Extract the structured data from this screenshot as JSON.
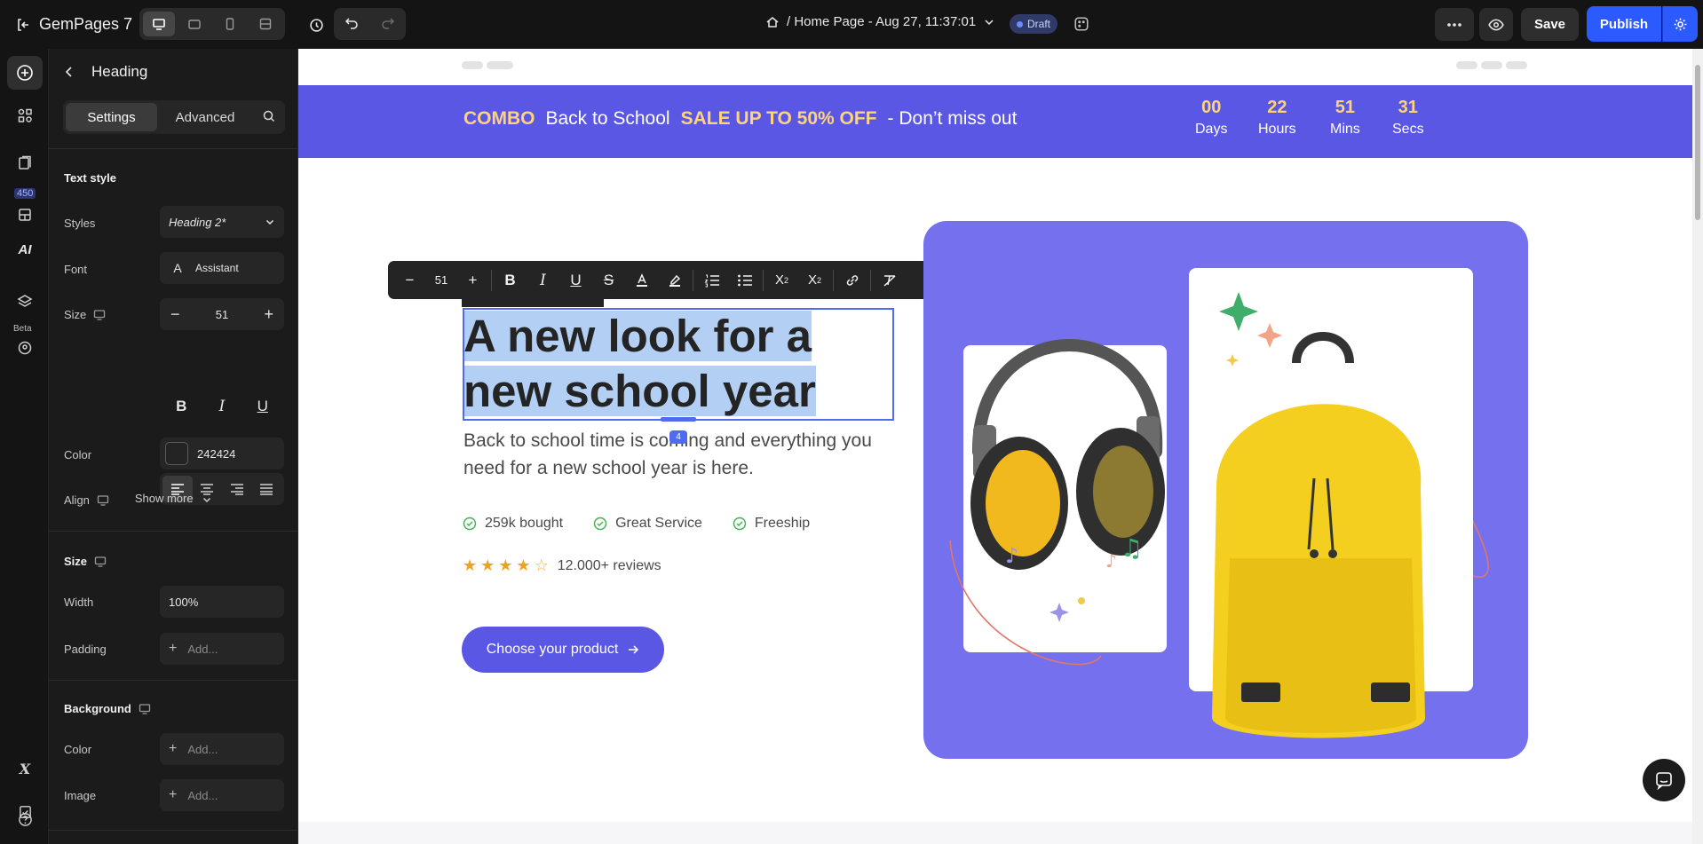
{
  "app": {
    "name": "GemPages 7",
    "page_title": "/ Home Page - Aug 27, 11:37:01",
    "status_badge": "Draft",
    "save_label": "Save",
    "publish_label": "Publish"
  },
  "rail": {
    "count_badge": "450",
    "beta_label": "Beta",
    "ai_label": "AI"
  },
  "panel": {
    "back_title": "Heading",
    "tabs": [
      "Settings",
      "Advanced"
    ],
    "text_style": {
      "title": "Text style",
      "styles_label": "Styles",
      "styles_value": "Heading 2*",
      "font_label": "Font",
      "font_value": "Assistant",
      "font_badge": "A",
      "size_label": "Size",
      "size_value": "51",
      "color_label": "Color",
      "color_value": "242424",
      "align_label": "Align",
      "show_more": "Show more"
    },
    "size": {
      "title": "Size",
      "width_label": "Width",
      "width_value": "100%",
      "padding_label": "Padding",
      "padding_value": "Add..."
    },
    "background": {
      "title": "Background",
      "color_label": "Color",
      "color_value": "Add...",
      "image_label": "Image",
      "image_value": "Add..."
    }
  },
  "toolbar": {
    "font_size": "51"
  },
  "canvas": {
    "banner": {
      "combo": "COMBO",
      "back_to_school": "Back to School",
      "sale": "SALE UP TO 50% OFF",
      "dont_miss": "- Don’t miss out",
      "countdown": [
        {
          "num": "00",
          "label": "Days"
        },
        {
          "num": "22",
          "label": "Hours"
        },
        {
          "num": "51",
          "label": "Mins"
        },
        {
          "num": "31",
          "label": "Secs"
        }
      ]
    },
    "heading": "A new look for a new school year",
    "selection_badge": "4",
    "subtext": "Back to school time is coming and everything you need for a new school year is here.",
    "features": [
      "259k bought",
      "Great Service",
      "Freeship"
    ],
    "reviews": "12.000+ reviews",
    "cta_label": "Choose your product"
  },
  "colors": {
    "accent": "#5b57e5",
    "publish": "#2b5bff",
    "highlight": "#ffd37a",
    "heading_text": "#242424",
    "selection": "#b3cff4"
  }
}
